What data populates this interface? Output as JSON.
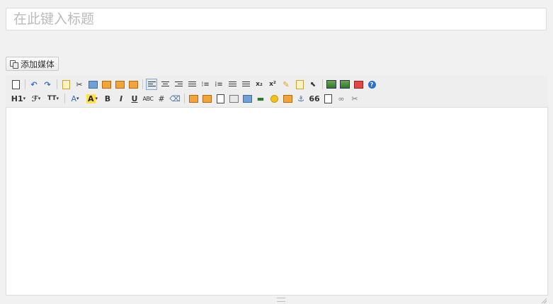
{
  "title": {
    "placeholder": "在此键入标题",
    "value": ""
  },
  "media_button": {
    "label": "添加媒体",
    "icon": "media-icon"
  },
  "toolbar": {
    "row1": [
      "paste-word-icon",
      "undo-icon",
      "redo-icon",
      "template-icon",
      "cut-icon",
      "copy-icon",
      "paste-icon",
      "paste-text-icon",
      "paste-from-word-icon",
      "align-left-icon",
      "align-center-icon",
      "align-right-icon",
      "justify-icon",
      "ordered-list-icon",
      "bullet-list-icon",
      "indent-icon",
      "outdent-icon",
      "subscript-icon",
      "superscript-icon",
      "clean-icon",
      "spellcheck-icon",
      "select-icon",
      "image-icon",
      "image-manager-icon",
      "fullscreen-icon",
      "help-icon"
    ],
    "row2": {
      "heading_label": "H1",
      "font_label": "ℱ",
      "size_label": "TT",
      "font_color_label": "A",
      "bg_color_label": "A",
      "bold_label": "B",
      "italic_label": "I",
      "underline_label": "U",
      "strike_label": "ABC",
      "hash_label": "#",
      "quote_label": "66"
    }
  },
  "colors": {
    "accent": "#2f6fd0",
    "highlight": "#ffe24a",
    "background": "#f1f1f1"
  }
}
